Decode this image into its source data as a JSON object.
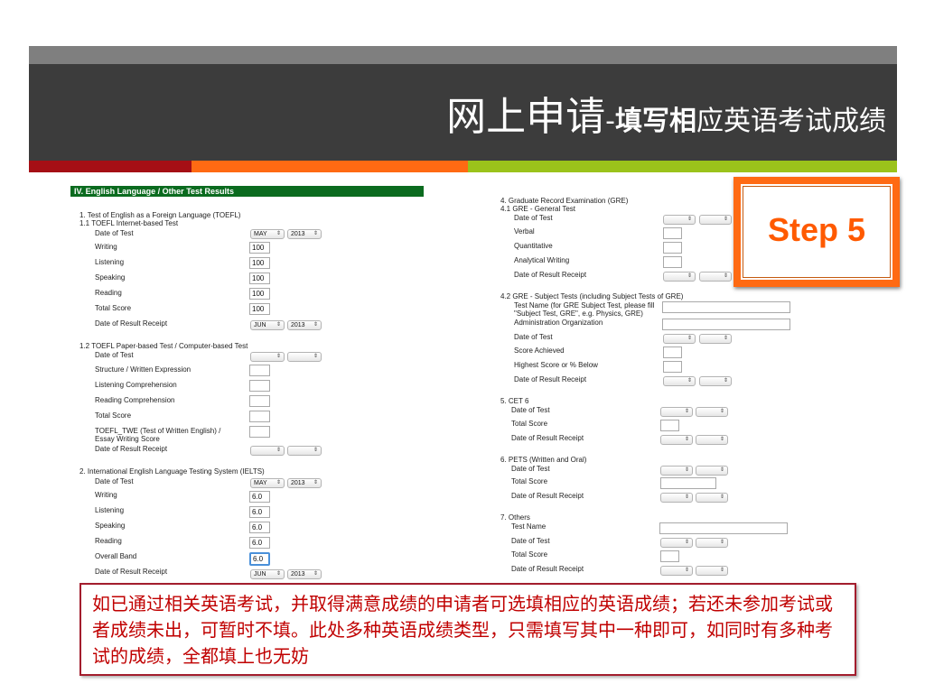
{
  "header": {
    "title_main": "网上申请",
    "title_sep": "-",
    "title_bold": "填写相",
    "title_rest": "应英语考试成绩"
  },
  "badge": {
    "label": "Step 5"
  },
  "section": {
    "title": "IV.    English Language / Other Test Results"
  },
  "left": {
    "toefl_heading": "1. Test of English as a Foreign Language (TOEFL)",
    "toefl_ibt_heading": "1.1 TOEFL Internet-based Test",
    "ibt": {
      "date_label": "Date of Test",
      "date_month": "MAY",
      "date_year": "2013",
      "writing_label": "Writing",
      "writing_value": "100",
      "listening_label": "Listening",
      "listening_value": "100",
      "speaking_label": "Speaking",
      "speaking_value": "100",
      "reading_label": "Reading",
      "reading_value": "100",
      "total_label": "Total Score",
      "total_value": "100",
      "receipt_label": "Date of Result Receipt",
      "receipt_month": "JUN",
      "receipt_year": "2013"
    },
    "pbt_heading": "1.2 TOEFL Paper-based Test / Computer-based Test",
    "pbt": {
      "date_label": "Date of Test",
      "structure_label": "Structure / Written Expression",
      "listening_label": "Listening Comprehension",
      "reading_label": "Reading Comprehension",
      "total_label": "Total Score",
      "twe_label_1": "TOEFL_TWE (Test of Written English) /",
      "twe_label_2": "Essay Writing Score",
      "receipt_label": "Date of Result Receipt"
    },
    "ielts_heading": "2. International English Language Testing System (IELTS)",
    "ielts": {
      "date_label": "Date of Test",
      "date_month": "MAY",
      "date_year": "2013",
      "writing_label": "Writing",
      "writing_value": "6.0",
      "listening_label": "Listening",
      "listening_value": "6.0",
      "speaking_label": "Speaking",
      "speaking_value": "6.0",
      "reading_label": "Reading",
      "reading_value": "6.0",
      "overall_label": "Overall Band",
      "overall_value": "6.0",
      "receipt_label": "Date of Result Receipt",
      "receipt_month": "JUN",
      "receipt_year": "2013"
    }
  },
  "right": {
    "gre_heading": "4. Graduate Record Examination (GRE)",
    "gre_general_heading": "4.1 GRE - General Test",
    "gre_general": {
      "date_label": "Date of Test",
      "verbal_label": "Verbal",
      "quant_label": "Quantitative",
      "analytical_label": "Analytical Writing",
      "receipt_label": "Date of Result Receipt"
    },
    "gre_subject_heading": "4.2 GRE - Subject Tests (including Subject Tests of GRE)",
    "gre_subject": {
      "name_label_1": "Test Name (for GRE Subject Test, please fill",
      "name_label_2": "\"Subject Test, GRE\", e.g. Physics, GRE)",
      "org_label": "Administration Organization",
      "date_label": "Date of Test",
      "score_label": "Score Achieved",
      "highest_label": "Highest Score or % Below",
      "receipt_label": "Date of Result Receipt"
    },
    "cet_heading": "5. CET 6",
    "cet": {
      "date_label": "Date of Test",
      "total_label": "Total Score",
      "receipt_label": "Date of Result Receipt"
    },
    "pets_heading": "6. PETS (Written and Oral)",
    "pets": {
      "date_label": "Date of Test",
      "total_label": "Total Score",
      "receipt_label": "Date of Result Receipt"
    },
    "others_heading": "7. Others",
    "others": {
      "name_label": "Test Name",
      "date_label": "Date of Test",
      "total_label": "Total Score",
      "receipt_label": "Date of Result Receipt"
    }
  },
  "note": {
    "text": "如已通过相关英语考试，并取得满意成绩的申请者可选填相应的英语成绩；若还未参加考试或者成绩未出，可暂时不填。此处多种英语成绩类型，只需填写其中一种即可，如同时有多种考试的成绩，全都填上也无妨"
  },
  "colors": {
    "header_bg": "#3c3c3c",
    "accent_red": "#a50f15",
    "accent_orange": "#ff6a13",
    "accent_green": "#9bc31b",
    "section_green": "#0b6b1f",
    "note_text": "#c00000"
  },
  "icons": {
    "select_arrow": "updown-arrow-icon"
  }
}
